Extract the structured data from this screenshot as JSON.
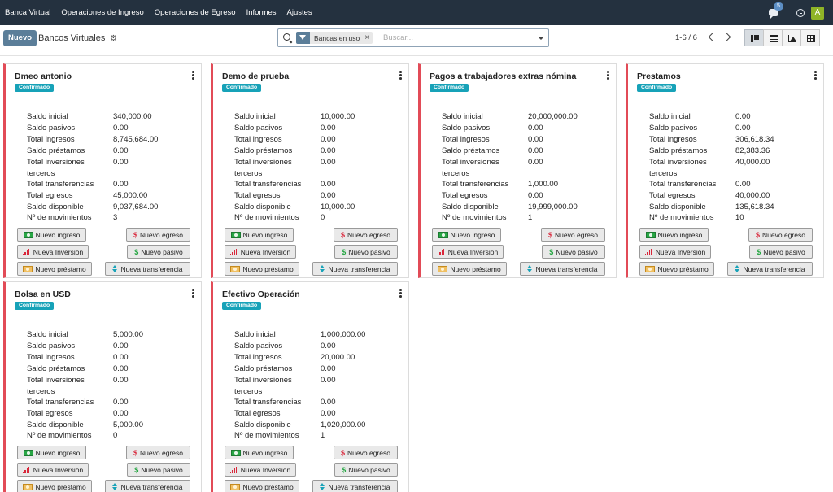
{
  "nav": {
    "items": [
      "Banca Virtual",
      "Operaciones de Ingreso",
      "Operaciones de Egreso",
      "Informes",
      "Ajustes"
    ],
    "chat_count": "5",
    "avatar_letter": "A"
  },
  "control": {
    "new_label": "Nuevo",
    "title": "Bancos Virtuales",
    "facet_label": "Bancas en uso",
    "search_placeholder": "Buscar...",
    "pager": "1-6 / 6"
  },
  "labels": {
    "status": "Confirmado",
    "rows": [
      "Saldo inicial",
      "Saldo pasivos",
      "Total ingresos",
      "Saldo préstamos",
      "Total inversiones",
      "terceros",
      "Total transferencias",
      "Total egresos",
      "Saldo disponible",
      "Nº de movimientos"
    ],
    "buttons": {
      "ingreso": "Nuevo ingreso",
      "egreso": "Nuevo egreso",
      "inversion": "Nueva Inversión",
      "pasivo": "Nuevo pasivo",
      "prestamo": "Nuevo préstamo",
      "transferencia": "Nueva transferencia"
    }
  },
  "accent_color": "#e24b57",
  "badge_color": "#17a2b8",
  "cards": [
    {
      "title": "Dmeo antonio",
      "values": [
        "340,000.00",
        "0.00",
        "8,745,684.00",
        "0.00",
        "0.00",
        "0.00",
        "45,000.00",
        "9,037,684.00",
        "3"
      ]
    },
    {
      "title": "Demo de prueba",
      "values": [
        "10,000.00",
        "0.00",
        "0.00",
        "0.00",
        "0.00",
        "0.00",
        "0.00",
        "10,000.00",
        "0"
      ]
    },
    {
      "title": "Pagos a trabajadores extras nómina",
      "values": [
        "20,000,000.00",
        "0.00",
        "0.00",
        "0.00",
        "0.00",
        "1,000.00",
        "0.00",
        "19,999,000.00",
        "1"
      ]
    },
    {
      "title": "Prestamos",
      "values": [
        "0.00",
        "0.00",
        "306,618.34",
        "82,383.36",
        "40,000.00",
        "0.00",
        "40,000.00",
        "135,618.34",
        "10"
      ]
    },
    {
      "title": "Bolsa en USD",
      "values": [
        "5,000.00",
        "0.00",
        "0.00",
        "0.00",
        "0.00",
        "0.00",
        "0.00",
        "5,000.00",
        "0"
      ]
    },
    {
      "title": "Efectivo Operación",
      "values": [
        "1,000,000.00",
        "0.00",
        "20,000.00",
        "0.00",
        "0.00",
        "0.00",
        "0.00",
        "1,020,000.00",
        "1"
      ]
    }
  ]
}
